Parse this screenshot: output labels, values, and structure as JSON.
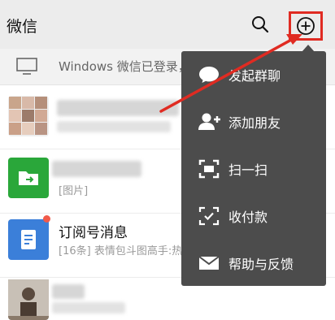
{
  "header": {
    "title": "微信"
  },
  "notice": {
    "text": "Windows 微信已登录，"
  },
  "chats": [
    {
      "title": "",
      "subtitle": ""
    },
    {
      "title": "",
      "subtitle": "[图片]"
    },
    {
      "title": "订阅号消息",
      "subtitle": "[16条] 表情包斗图高手:热"
    },
    {
      "title": "",
      "subtitle": ""
    }
  ],
  "menu": {
    "items": [
      {
        "label": "发起群聊",
        "icon": "chat-bubble-icon"
      },
      {
        "label": "添加朋友",
        "icon": "add-friend-icon"
      },
      {
        "label": "扫一扫",
        "icon": "scan-icon"
      },
      {
        "label": "收付款",
        "icon": "payment-icon"
      },
      {
        "label": "帮助与反馈",
        "icon": "mail-icon"
      }
    ]
  },
  "colors": {
    "menu_bg": "#4c4c4c",
    "highlight_red": "#e02b22",
    "file_green": "#2aa73a",
    "subscription_blue": "#3b7fd9"
  }
}
